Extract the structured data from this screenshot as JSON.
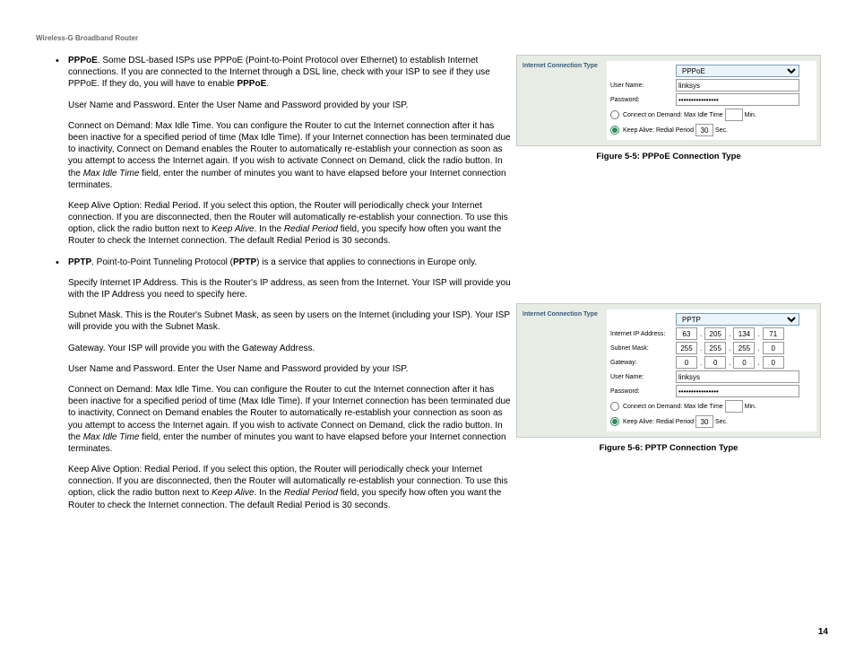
{
  "header": "Wireless-G Broadband Router",
  "pageNumber": "14",
  "body": {
    "pppoe": {
      "title": "PPPoE",
      "intro": ". Some DSL-based ISPs use PPPoE (Point-to-Point Protocol over Ethernet) to establish Internet connections. If you are connected to the Internet through a DSL line, check with your ISP to see if they use PPPoE. If they do, you will have to enable ",
      "introEnd": ".",
      "user": "User Name and Password. Enter the User Name and Password provided by your ISP.",
      "cod1": "Connect on Demand: Max Idle Time. You can configure the Router to cut the Internet connection after it has been inactive for a specified period of time (Max Idle Time). If your Internet connection has been terminated due to inactivity, Connect on Demand enables the Router to automatically re-establish your connection as soon as you attempt to access the Internet again. If you wish to activate Connect on Demand, click the radio button. In the ",
      "maxIdle": "Max Idle Time",
      "cod2": " field, enter the number of minutes you want to have elapsed before your Internet connection terminates.",
      "keep1": "Keep Alive Option: Redial Period. If you select this option, the Router will periodically check your Internet connection. If you are disconnected, then the Router will automatically re-establish your connection. To use this option, click the radio button next to ",
      "keepAliveI": "Keep Alive",
      "keep2": ". In the ",
      "redialI": "Redial Period",
      "keep3": " field, you specify how often you want the Router to check the Internet connection.  The default Redial Period is 30 seconds."
    },
    "pptp": {
      "title": "PPTP",
      "intro1": ". Point-to-Point Tunneling Protocol (",
      "intro2": ") is a service that applies to connections in Europe only.",
      "ip": "Specify Internet IP Address. This is the Router's IP address, as seen from the Internet. Your ISP will provide you with the IP Address you need to specify here.",
      "subnet": "Subnet Mask. This is the Router's Subnet Mask, as seen by users on the Internet (including your ISP). Your ISP will provide you with the Subnet Mask.",
      "gateway": "Gateway. Your ISP will provide you with the Gateway Address.",
      "user": "User Name and Password. Enter the User Name and Password provided by your ISP.",
      "cod1": "Connect on Demand: Max Idle Time. You can configure the Router to cut the Internet connection after it has been inactive for a specified period of time (Max Idle Time). If your Internet connection has been terminated due to inactivity, Connect on Demand enables the Router to automatically re-establish your connection as soon as you attempt to access the Internet again. If you wish to activate Connect on Demand, click the radio button. In the ",
      "maxIdle": "Max Idle Time",
      "cod2": " field, enter the number of minutes you want to have elapsed before your Internet connection terminates.",
      "keep1": "Keep Alive Option: Redial Period. If you select this option, the Router will periodically check your Internet connection. If you are disconnected, then the Router will automatically re-establish your connection. To use this option, click the radio button next to ",
      "keepAliveI": "Keep Alive",
      "keep2": ". In the ",
      "redialI": "Redial Period",
      "keep3": " field, you specify how often you want the Router to check the Internet connection. The default Redial Period is 30 seconds."
    }
  },
  "fig5": {
    "sideLabel": "Internet Connection Type",
    "select": "PPPoE",
    "userLabel": "User Name:",
    "userVal": "linksys",
    "passLabel": "Password:",
    "passVal": "••••••••••••••••",
    "codLabel": "Connect on Demand: Max Idle Time",
    "codMin": "Min.",
    "keepLabel": "Keep Alive: Redial Period",
    "keepVal": "30",
    "keepSec": "Sec.",
    "caption": "Figure 5-5: PPPoE Connection Type"
  },
  "fig6": {
    "sideLabel": "Internet Connection Type",
    "select": "PPTP",
    "ipLabel": "Internet IP Address:",
    "ip": [
      "63",
      "205",
      "134",
      "71"
    ],
    "subnetLabel": "Subnet Mask:",
    "subnet": [
      "255",
      "255",
      "255",
      "0"
    ],
    "gwLabel": "Gateway:",
    "gw": [
      "0",
      "0",
      "0",
      "0"
    ],
    "userLabel": "User Name:",
    "userVal": "linksys",
    "passLabel": "Password:",
    "passVal": "••••••••••••••••",
    "codLabel": "Connect on Demand: Max Idle Time",
    "codMin": "Min.",
    "keepLabel": "Keep Alive: Redial Period",
    "keepVal": "30",
    "keepSec": "Sec.",
    "caption": "Figure 5-6: PPTP Connection Type"
  }
}
